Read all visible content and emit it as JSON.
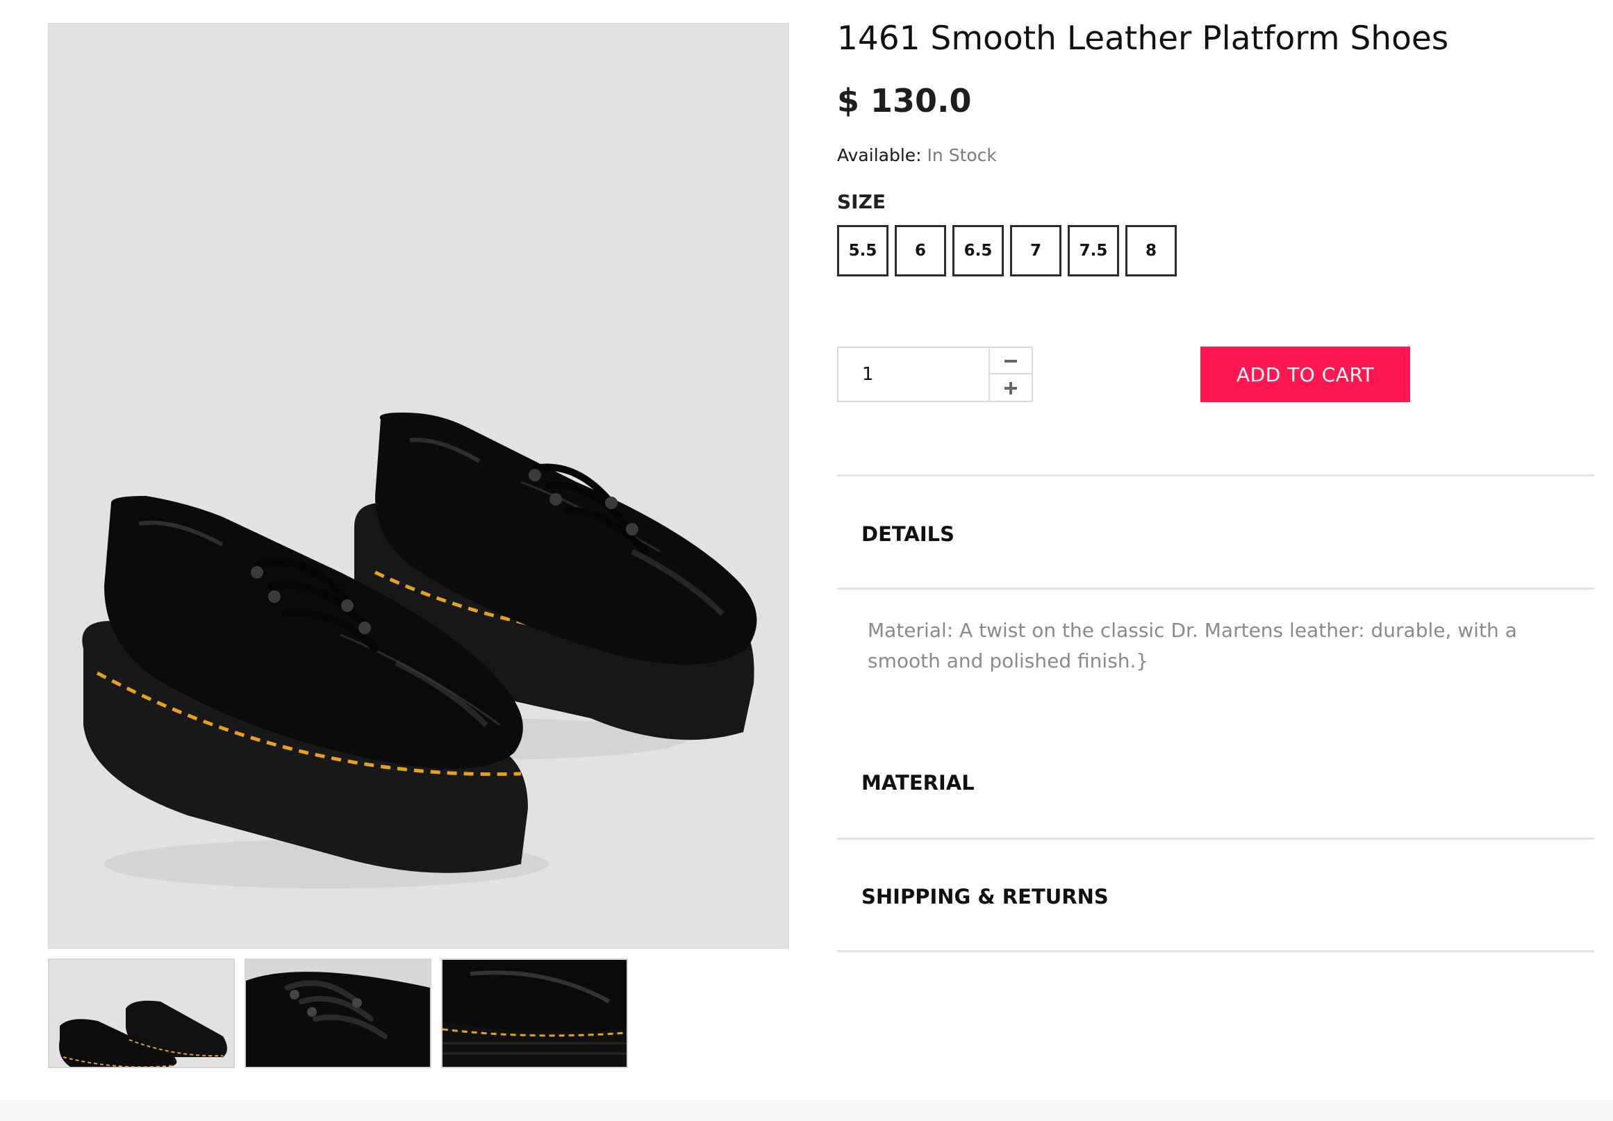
{
  "product": {
    "title": "1461 Smooth Leather Platform Shoes",
    "price": "$ 130.0",
    "availability_label": "Available:",
    "availability_value": "In Stock"
  },
  "size": {
    "label": "SIZE",
    "options": [
      "5.5",
      "6",
      "6.5",
      "7",
      "7.5",
      "8"
    ]
  },
  "quantity": {
    "value": "1",
    "minus_icon": "minus-icon",
    "plus_icon": "plus-icon"
  },
  "cart": {
    "add_label": "ADD TO CART",
    "color": "#ff1752"
  },
  "accordion": {
    "details": {
      "title": "DETAILS",
      "body": "Material: A twist on the classic Dr. Martens leather: durable, with a smooth and polished finish.}"
    },
    "material": {
      "title": "MATERIAL"
    },
    "shipping": {
      "title": "SHIPPING & RETURNS"
    }
  },
  "gallery": {
    "background": "#e2e2e2",
    "stitch_color": "#e8a21a"
  }
}
